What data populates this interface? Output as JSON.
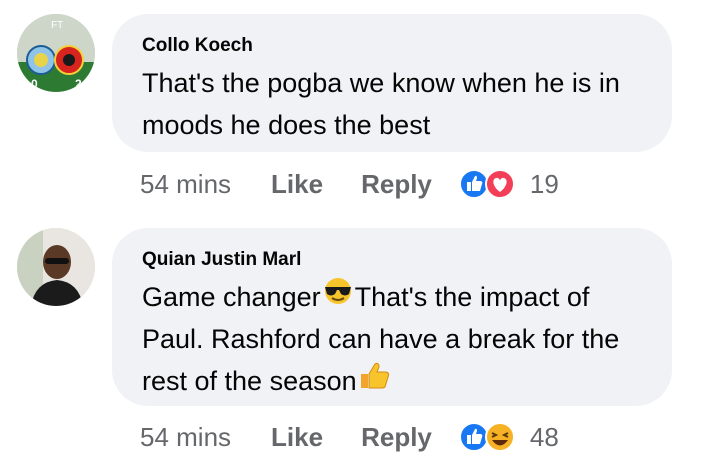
{
  "comments": [
    {
      "author": "Collo Koech",
      "avatar_badge": "FT",
      "text_parts": [
        "That's the pogba we know when he is in moods he does the best"
      ],
      "time": "54 mins",
      "like_label": "Like",
      "reply_label": "Reply",
      "reactions": [
        "like-icon",
        "love-icon"
      ],
      "reaction_count": "19"
    },
    {
      "author": "Quian Justin Marl",
      "text_parts": [
        "Game changer",
        "That's the impact of Paul. Rashford can have a break for the rest of the season"
      ],
      "emojis": [
        "sunglasses-emoji",
        "thumbs-up-emoji"
      ],
      "time": "54 mins",
      "like_label": "Like",
      "reply_label": "Reply",
      "reactions": [
        "like-icon",
        "haha-icon"
      ],
      "reaction_count": "48"
    }
  ],
  "colors": {
    "bubble": "#f0f2f5",
    "meta_text": "#65676b",
    "like_blue": "#1877f2",
    "love_red": "#f33e58",
    "haha_yellow": "#f7b125"
  }
}
